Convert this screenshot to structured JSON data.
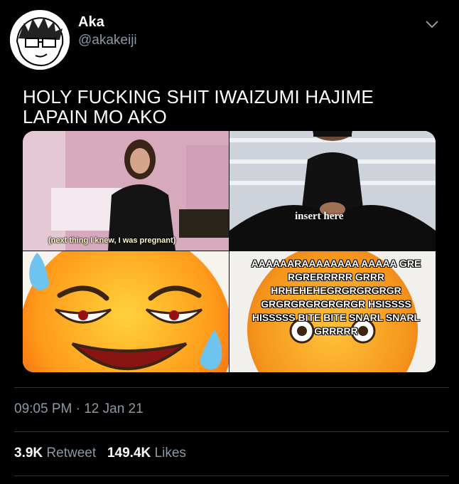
{
  "author": {
    "name": "Aka",
    "handle": "@akakeiji"
  },
  "tweet": {
    "text": "HOLY FUCKING SHIT IWAIZUMI HAJIME LAPAIN MO AKO"
  },
  "media": {
    "panel1_caption": "(next thing I knew, I was pregnant)",
    "panel2_caption": "insert here",
    "panel4_text": "AAAAAARAAAAAAAA AAAAA GRE RGRERRRRR GRRR HRHEHEHEGRGRGRGRGR GRGRGRGRGRGRGR HSISSSS HISSSSS BITE BITE SNARL SNARL GRRRRR"
  },
  "meta": {
    "time": "09:05 PM",
    "separator": "·",
    "date": "12 Jan 21"
  },
  "stats": {
    "retweets_count": "3.9K",
    "retweets_label": "Retweet",
    "likes_count": "149.4K",
    "likes_label": "Likes"
  },
  "icons": {
    "more": "chevron-down-icon"
  },
  "colors": {
    "background": "#000000",
    "secondary_text": "#8b98a5",
    "divider": "#2f3336"
  }
}
